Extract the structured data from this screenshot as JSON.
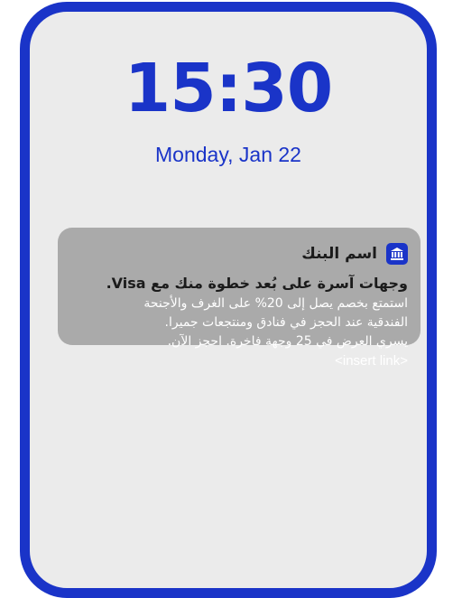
{
  "lockscreen": {
    "time": "15:30",
    "date": "Monday, Jan 22"
  },
  "notification": {
    "app_name": "اسم البنك",
    "app_icon": "bank-icon",
    "title": "وجهات آسرة على بُعد خطوة منك مع Visa.",
    "body_lines": [
      "استمتع بخصم يصل إلى 20% على الغرف والأجنحة",
      "الفندقية عند الحجز في فنادق ومنتجعات جميرا.",
      "يسري العرض في 25 وجهة فاخرة. احجز الآن."
    ],
    "link_placeholder": "<insert link>"
  },
  "colors": {
    "accent": "#1a34c8",
    "screen_background": "#ebebeb",
    "notification_background": "#aaaaaa"
  }
}
